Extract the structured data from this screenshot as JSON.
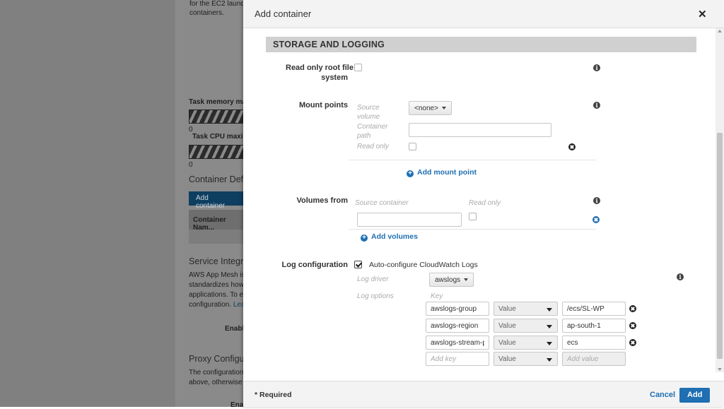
{
  "background": {
    "intro_text": [
      "for the EC2 launch",
      "containers."
    ],
    "task_memory_label": "Task memory max",
    "task_memory_value": "0",
    "task_cpu_label": "Task CPU maxim",
    "task_cpu_value": "0",
    "container_def_heading": "Container Defi",
    "add_container_btn": "Add container",
    "table_header": "Container Nam...",
    "service_heading": "Service Integra",
    "service_text": [
      "AWS App Mesh is a",
      "standardizes how y",
      "applications. To ena",
      "configuration."
    ],
    "service_link": "Learn",
    "enable_label": "Enabl",
    "proxy_heading": "Proxy Configur",
    "proxy_text": [
      "The configuration d",
      "above, otherwise n"
    ],
    "bottom_cut": "Ena"
  },
  "modal": {
    "title": "Add container",
    "section_header": "STORAGE AND LOGGING",
    "read_only_root": {
      "label_line1": "Read only root file",
      "label_line2": "system",
      "checked": false
    },
    "mount_points": {
      "label": "Mount points",
      "source_volume_label": [
        "Source",
        "volume"
      ],
      "source_volume_value": "<none>",
      "container_path_label": [
        "Container",
        "path"
      ],
      "container_path_value": "",
      "read_only_label": "Read only",
      "add_link": "Add mount point"
    },
    "volumes_from": {
      "label": "Volumes from",
      "source_container_label": "Source container",
      "read_only_label": "Read only",
      "source_container_value": "",
      "add_link": "Add volumes"
    },
    "log_configuration": {
      "label": "Log configuration",
      "auto_configure_label": "Auto-configure CloudWatch Logs",
      "auto_configure_checked": true,
      "log_driver_label": "Log driver",
      "log_driver_value": "awslogs",
      "log_options_label": "Log options",
      "key_header": "Key",
      "options": [
        {
          "key": "awslogs-group",
          "type": "Value",
          "value": "/ecs/SL-WP"
        },
        {
          "key": "awslogs-region",
          "type": "Value",
          "value": "ap-south-1"
        },
        {
          "key": "awslogs-stream-prefix",
          "type": "Value",
          "value": "ecs"
        }
      ],
      "new_row": {
        "key_placeholder": "Add key",
        "type": "Value",
        "value_placeholder": "Add value"
      }
    },
    "footer": {
      "required_note": "* Required",
      "cancel": "Cancel",
      "add": "Add"
    }
  },
  "colors": {
    "accent": "#1f6fb2",
    "section_header_bg": "#d0d0d0",
    "overlay": "#8a8a8a"
  },
  "icons": [
    "close-icon",
    "info-icon",
    "remove-icon",
    "plus-circle-icon",
    "checkmark-icon",
    "caret-down-icon"
  ]
}
